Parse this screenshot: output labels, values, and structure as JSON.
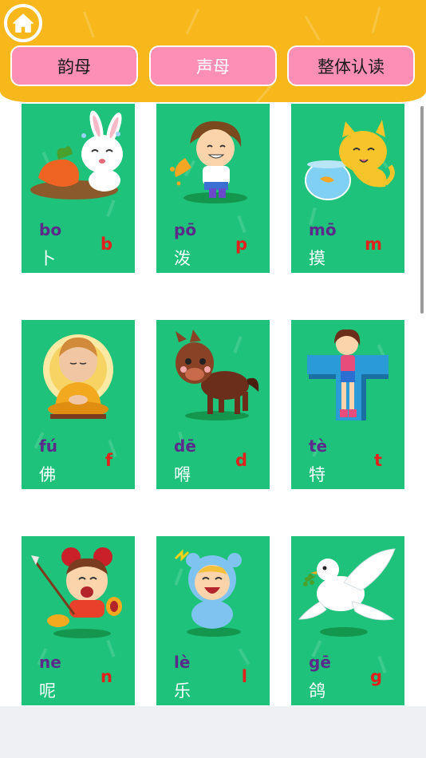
{
  "header": {
    "home_icon": "home-icon",
    "colors": {
      "header": "#f8b81b",
      "tab": "#fd8fb7",
      "card": "#1ec27a",
      "pinyin": "#5b2a8a",
      "letter": "#e2201c"
    },
    "tabs": [
      {
        "label": "韵母",
        "active": false
      },
      {
        "label": "声母",
        "active": true
      },
      {
        "label": "整体认读",
        "active": false
      }
    ]
  },
  "cards": [
    {
      "pinyin": "bo",
      "hanzi": "卜",
      "letter": "b",
      "icon": "rabbit-carrot-icon"
    },
    {
      "pinyin": "pō",
      "hanzi": "泼",
      "letter": "p",
      "icon": "boy-splashing-icon"
    },
    {
      "pinyin": "mō",
      "hanzi": "摸",
      "letter": "m",
      "icon": "cat-fishbowl-icon"
    },
    {
      "pinyin": "fú",
      "hanzi": "佛",
      "letter": "f",
      "icon": "buddha-icon"
    },
    {
      "pinyin": "dē",
      "hanzi": "嘚",
      "letter": "d",
      "icon": "horse-icon"
    },
    {
      "pinyin": "tè",
      "hanzi": "特",
      "letter": "t",
      "icon": "girl-letter-t-icon"
    },
    {
      "pinyin": "ne",
      "hanzi": "呢",
      "letter": "n",
      "icon": "nezha-icon"
    },
    {
      "pinyin": "lè",
      "hanzi": "乐",
      "letter": "l",
      "icon": "laughing-baby-icon"
    },
    {
      "pinyin": "gē",
      "hanzi": "鸽",
      "letter": "g",
      "icon": "dove-icon"
    }
  ]
}
